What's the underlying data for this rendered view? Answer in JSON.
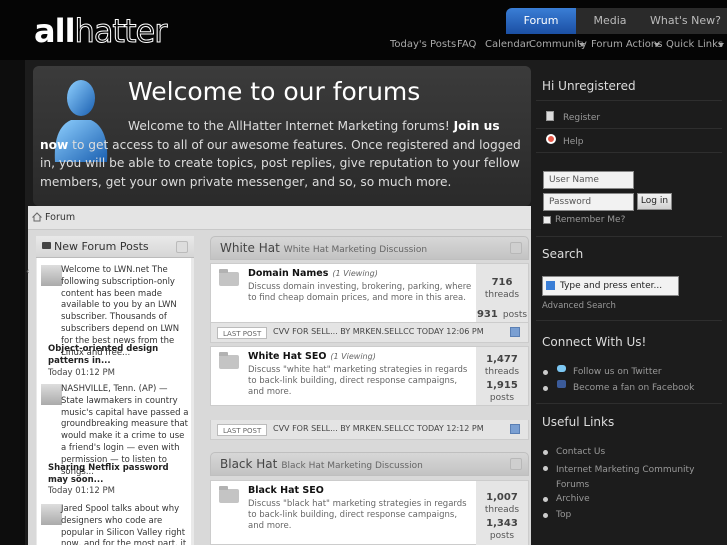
{
  "header": {
    "logo": "allhatter",
    "nav_tabs": [
      "Forum",
      "Media",
      "What's New?"
    ],
    "subnav": [
      "Today's Posts",
      "FAQ",
      "Calendar",
      "Community",
      "Forum Actions",
      "Quick Links"
    ]
  },
  "welcome": {
    "title": "Welcome to our forums",
    "text_before": "Welcome to the AllHatter Internet Marketing forums! ",
    "join_link": "Join us now",
    "text_after": " to get access to all of our awesome features. Once registered and logged in, you will be able to create topics, post replies, give reputation to your fellow members, get your own private messenger, and so, so much more."
  },
  "breadcrumb": "Forum",
  "news_panel": {
    "title": "New Forum Posts",
    "items": [
      {
        "text": "Welcome to LWN.net The following subscription-only content has been made available to you by an LWN subscriber. Thousands of subscribers depend on LWN for the best news from the Linux and free...",
        "title": "Object-oriented design patterns in...",
        "time": "Today 01:12 PM"
      },
      {
        "text": "NASHVILLE, Tenn. (AP) — State lawmakers in country music's capital have passed a groundbreaking measure that would make it a crime to use a friend's login — even with permission — to listen to songs...",
        "title": "Sharing Netflix password may soon...",
        "time": "Today 01:12 PM"
      },
      {
        "text": "Jared Spool talks about why designers who code are popular in Silicon Valley right now, and for the most part, it boils down to this"
      }
    ]
  },
  "categories": [
    {
      "title": "White Hat",
      "desc": "White Hat Marketing Discussion",
      "forums": [
        {
          "name": "Domain Names",
          "viewing": "(1 Viewing)",
          "desc": "Discuss domain investing, brokering, parking, where to find cheap domain prices, and more in this area.",
          "threads": "716",
          "threads_label": "threads",
          "posts": "931",
          "posts_label": "posts",
          "last_post": "CVV FOR SELL... BY MRKEN.SELLCC TODAY 12:06 PM"
        },
        {
          "name": "White Hat SEO",
          "viewing": "(1 Viewing)",
          "desc": "Discuss \"white hat\" marketing strategies in regards to back-link building, direct response campaigns, and more.",
          "threads": "1,477",
          "threads_label": "threads",
          "posts": "1,915",
          "posts_label": "posts",
          "last_post": "CVV FOR SELL... BY MRKEN.SELLCC TODAY 12:12 PM"
        }
      ]
    },
    {
      "title": "Black Hat",
      "desc": "Black Hat Marketing Discussion",
      "forums": [
        {
          "name": "Black Hat SEO",
          "desc": "Discuss \"black hat\" marketing strategies in regards to back-link building, direct response campaigns, and more.",
          "threads": "1,007",
          "threads_label": "threads",
          "posts": "1,343",
          "posts_label": "posts"
        }
      ]
    }
  ],
  "last_post_label": "LAST POST",
  "sidebar": {
    "greeting": "Hi Unregistered",
    "register": "Register",
    "help": "Help",
    "username_placeholder": "User Name",
    "password_placeholder": "Password",
    "login_button": "Log in",
    "remember_me": "Remember Me?",
    "search_title": "Search",
    "search_placeholder": "Type and press enter...",
    "advanced_search": "Advanced Search",
    "connect_title": "Connect With Us!",
    "twitter": "Follow us on Twitter",
    "facebook": "Become a fan on Facebook",
    "useful_title": "Useful Links",
    "useful_links": [
      "Contact Us",
      "Internet Marketing Community Forums",
      "Archive",
      "Top"
    ]
  },
  "colors": {
    "accent_blue": "#2a64c0",
    "dark_bg": "#1c1c1c"
  }
}
